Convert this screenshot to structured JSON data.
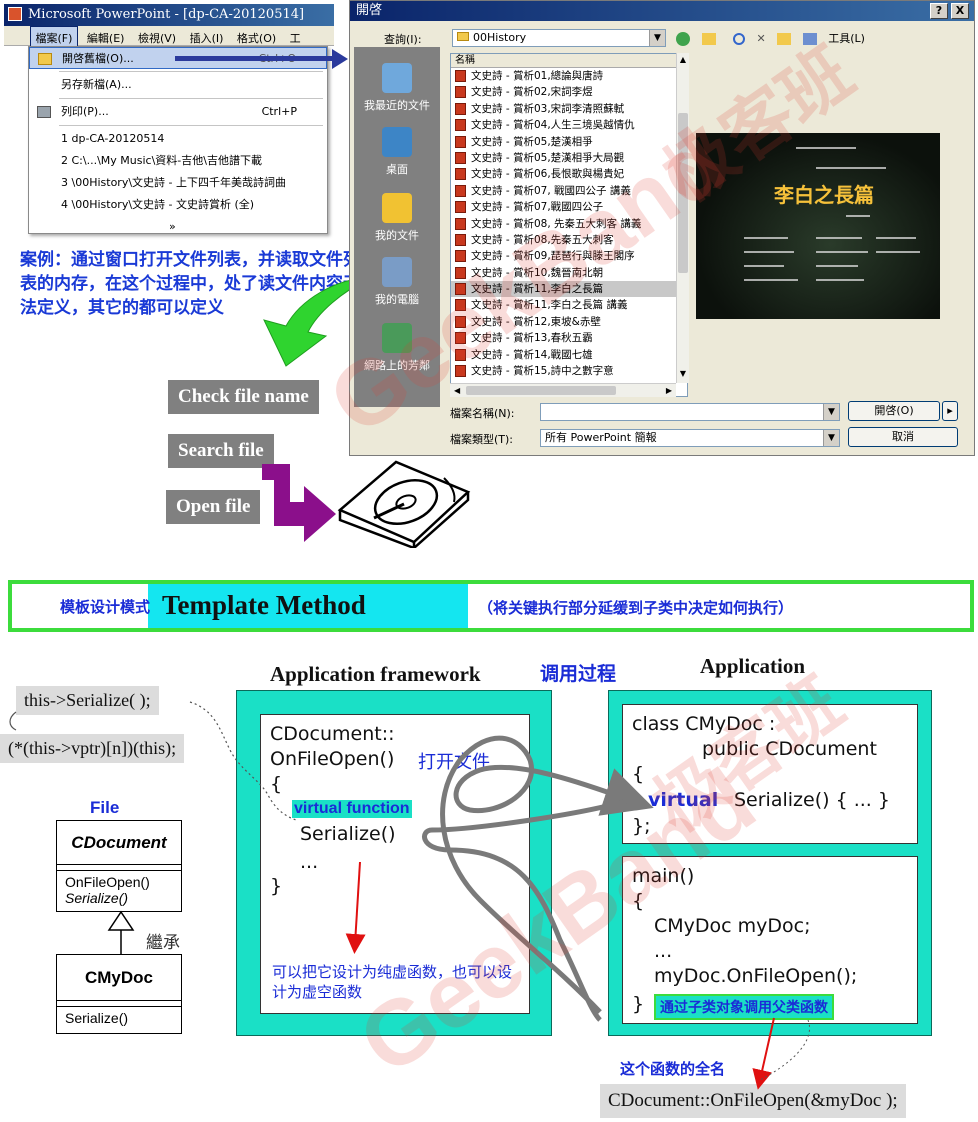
{
  "powerpoint": {
    "title": "Microsoft PowerPoint - [dp-CA-20120514]",
    "menubar": [
      "檔案(F)",
      "編輯(E)",
      "檢視(V)",
      "插入(I)",
      "格式(O)",
      "工"
    ],
    "file_menu": {
      "open": "開啓舊檔(O)...",
      "open_shortcut": "Ctrl+O",
      "save_as": "另存新檔(A)...",
      "print": "列印(P)...",
      "print_shortcut": "Ctrl+P",
      "recent": [
        "1 dp-CA-20120514",
        "2 C:\\...\\My Music\\資料-吉他\\吉他譜下載",
        "3 \\00History\\文史詩 - 上下四千年美哉詩詞曲",
        "4 \\00History\\文史詩 - 文史詩賞析 (全)"
      ],
      "more": "»"
    }
  },
  "case_text": "案例：通过窗口打开文件列表，并读取文件列表的内存，在这个过程中，处了读文件内容无法定义，其它的都可以定义",
  "steps": [
    "Check file name",
    "Search file",
    "Open file"
  ],
  "open_dialog": {
    "title": "開啓",
    "help_btn": "?",
    "close_btn": "X",
    "lookin_label": "查詢(I):",
    "lookin_value": "00History",
    "toolbar_tools": "工具(L)",
    "places": [
      "我最近的文件",
      "桌面",
      "我的文件",
      "我的電腦",
      "網路上的芳鄰"
    ],
    "list_header": "名稱",
    "files": [
      "文史詩 - 賞析01,總論與唐詩",
      "文史詩 - 賞析02,宋詞李煜",
      "文史詩 - 賞析03,宋詞李清照蘇軾",
      "文史詩 - 賞析04,人生三境吳越情仇",
      "文史詩 - 賞析05,楚漢相爭",
      "文史詩 - 賞析05,楚漢相爭大局觀",
      "文史詩 - 賞析06,長恨歌與楊貴妃",
      "文史詩 - 賞析07, 戰國四公子 講義",
      "文史詩 - 賞析07,戰國四公子",
      "文史詩 - 賞析08, 先秦五大刺客 講義",
      "文史詩 - 賞析08,先秦五大刺客",
      "文史詩 - 賞析09,琵琶行與滕王閣序",
      "文史詩 - 賞析10,魏晉南北朝",
      "文史詩 - 賞析11,李白之長篇",
      "文史詩 - 賞析11,李白之長篇 講義",
      "文史詩 - 賞析12,東坡&赤壁",
      "文史詩 - 賞析13,春秋五霸",
      "文史詩 - 賞析14,戰國七雄",
      "文史詩 - 賞析15,詩中之數字意"
    ],
    "selected_index": 13,
    "preview_title": "李白之長篇",
    "filename_label": "檔案名稱(N):",
    "filename_value": "",
    "filetype_label": "檔案類型(T):",
    "filetype_value": "所有 PowerPoint 簡報",
    "open_button": "開啓(O)",
    "cancel_button": "取消"
  },
  "banner": {
    "left": "模板设计模式",
    "title": "Template Method",
    "right": "（将关键执行部分延缓到子类中决定如何执行）"
  },
  "diagram": {
    "framework_heading": "Application framework",
    "call_process": "调用过程",
    "application_heading": "Application",
    "callout_serialize": "this->Serialize( );",
    "callout_vptr": "(*(this->vptr)[n])(this);",
    "uml_package": "File",
    "uml_parent": {
      "name": "CDocument",
      "ops": [
        "OnFileOpen()",
        "Serialize()"
      ]
    },
    "inherit_label": "繼承",
    "uml_child": {
      "name": "CMyDoc",
      "ops": [
        "Serialize()"
      ]
    },
    "framework_code": {
      "line1": "CDocument::",
      "line2": "OnFileOpen()",
      "open_file_note": "打开文件",
      "brace_open": "{",
      "virtual_note": "virtual function",
      "serialize": "Serialize()",
      "ellipsis": "...",
      "brace_close": "}"
    },
    "pure_virtual_note": "可以把它设计为纯虚函数，也可以设计为虚空函数",
    "class_code": {
      "line1": "class CMyDoc :",
      "line2": "public CDocument",
      "brace_open": "{",
      "virtual_kw": "virtual",
      "serialize": "Serialize() { ... }",
      "brace_close": "};"
    },
    "main_code": {
      "line1": "main()",
      "brace_open": "{",
      "decl": "CMyDoc myDoc;",
      "ellipsis": "...",
      "call": "myDoc.OnFileOpen();",
      "brace_close": "}"
    },
    "subclass_note": "通过子类对象调用父类函数",
    "fullname_note": "这个函数的全名",
    "fullname_code": "CDocument::OnFileOpen(&myDoc );"
  },
  "watermarks": [
    "极客班",
    "GeekBand"
  ],
  "colors": {
    "accent_blue": "#1a2cd6",
    "teal": "#1ae0c6",
    "banner_border": "#3cdc3c",
    "cyan": "#14e6f0",
    "red_arrow": "#e01010",
    "purple_arrow": "#8b0f8b",
    "green_arrow": "#2fd42f"
  }
}
